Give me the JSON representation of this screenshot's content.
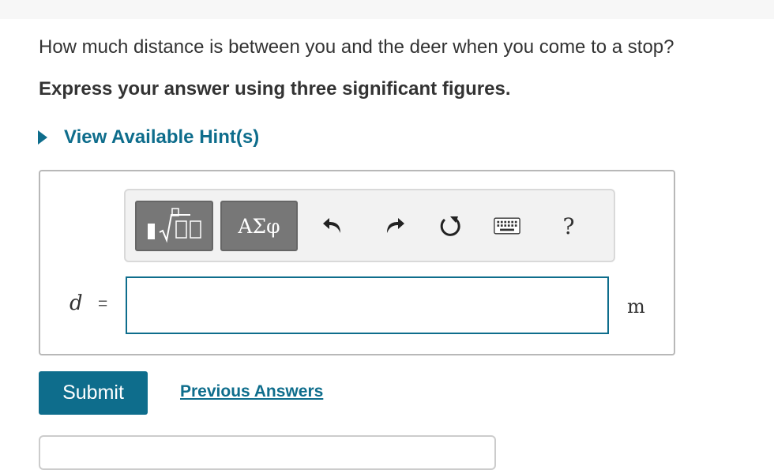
{
  "question": {
    "text": "How much distance is between you and the deer when you come to a stop?",
    "instruction": "Express your answer using three significant figures."
  },
  "hints": {
    "label": "View Available Hint(s)"
  },
  "answer": {
    "variable": "d",
    "equals": "=",
    "value": "",
    "unit": "m"
  },
  "toolbar": {
    "template_button": "fraction-radical-template-icon",
    "greek_label": "ΑΣφ",
    "undo": "undo-icon",
    "redo": "redo-icon",
    "reset": "reset-icon",
    "keyboard": "keyboard-icon",
    "help_label": "?"
  },
  "actions": {
    "submit_label": "Submit",
    "previous_answers_label": "Previous Answers"
  },
  "colors": {
    "accent": "#0e6d8c",
    "toolbar_button": "#777777",
    "text": "#333333"
  }
}
